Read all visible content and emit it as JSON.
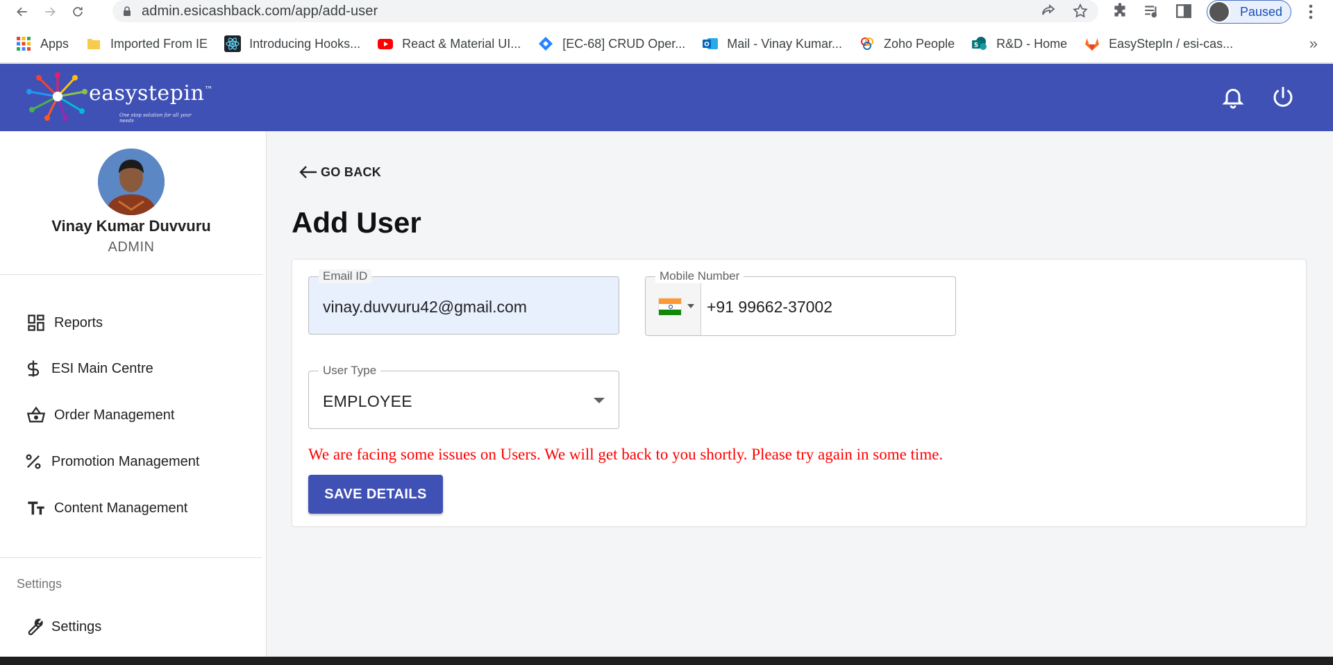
{
  "browser": {
    "url": "admin.esicashback.com/app/add-user",
    "profile_status": "Paused",
    "bookmarks": [
      {
        "label": "Apps",
        "icon": "apps-grid-icon"
      },
      {
        "label": "Imported From IE",
        "icon": "folder-icon"
      },
      {
        "label": "Introducing Hooks...",
        "icon": "react-icon"
      },
      {
        "label": "React & Material UI...",
        "icon": "youtube-icon"
      },
      {
        "label": "[EC-68] CRUD Oper...",
        "icon": "jira-icon"
      },
      {
        "label": "Mail - Vinay Kumar...",
        "icon": "outlook-icon"
      },
      {
        "label": "Zoho People",
        "icon": "zoho-icon"
      },
      {
        "label": "R&D - Home",
        "icon": "sharepoint-icon"
      },
      {
        "label": "EasyStepIn / esi-cas...",
        "icon": "gitlab-icon"
      }
    ],
    "more_bookmarks": "»"
  },
  "header": {
    "brand": "easystepin",
    "brand_tm": "™",
    "tagline": "One stop solution for all your needs",
    "icons": [
      "bell-icon",
      "power-icon"
    ]
  },
  "sidebar": {
    "user_name": "Vinay Kumar Duvvuru",
    "user_role": "ADMIN",
    "items": [
      {
        "label": "Reports",
        "icon": "dashboard-icon"
      },
      {
        "label": "ESI Main Centre",
        "icon": "dollar-icon"
      },
      {
        "label": "Order Management",
        "icon": "basket-icon"
      },
      {
        "label": "Promotion Management",
        "icon": "percent-icon"
      },
      {
        "label": "Content Management",
        "icon": "text-size-icon"
      }
    ],
    "settings_heading": "Settings",
    "settings_item": {
      "label": "Settings",
      "icon": "wrench-icon"
    }
  },
  "main": {
    "go_back": "GO BACK",
    "title": "Add User",
    "form": {
      "email_label": "Email ID",
      "email_value": "vinay.duvvuru42@gmail.com",
      "mobile_label": "Mobile Number",
      "mobile_value": "+91 99662-37002",
      "user_type_label": "User Type",
      "user_type_value": "EMPLOYEE",
      "error": "We are facing some issues on Users. We will get back to you shortly. Please try again in some time.",
      "save_label": "SAVE DETAILS"
    }
  },
  "colors": {
    "primary": "#3f51b5",
    "error": "#ff0000",
    "autofill_bg": "#e8f0fe"
  }
}
